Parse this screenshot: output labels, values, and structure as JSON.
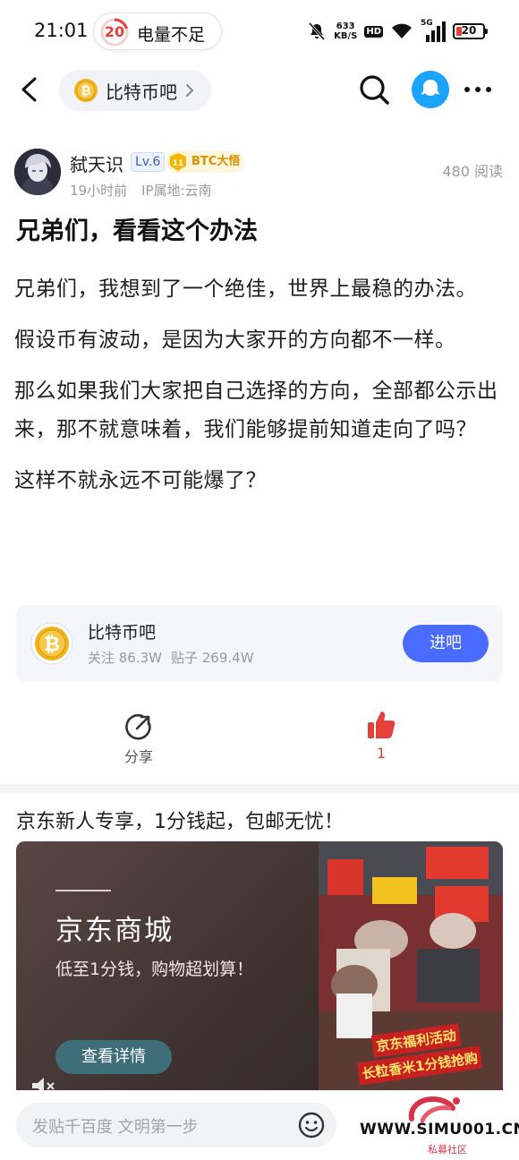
{
  "status_bar": {
    "time": "21:01",
    "battery_ring_value": "20",
    "battery_warning": "电量不足",
    "net_speed_value": "633",
    "net_speed_unit": "KB/S",
    "hd_label": "HD",
    "signal_label": "5G",
    "battery_level": "20",
    "battery_level_fraction": 0.2,
    "icons": [
      "mute-icon",
      "hd-icon",
      "wifi-icon",
      "signal-5g-icon",
      "battery-icon"
    ],
    "colors": {
      "battery_warning": "#e5413a"
    }
  },
  "nav": {
    "forum_name": "比特币吧",
    "icons": [
      "back-arrow-icon",
      "bitcoin-coin-icon",
      "chevron-right-icon",
      "search-icon",
      "assistant-icon",
      "more-icon"
    ]
  },
  "author": {
    "name": "弑天识",
    "level": "Lv.6",
    "title_badge_num": "11",
    "title_badge": "BTC大悟",
    "time_ago": "19小时前",
    "ip_location": "IP属地:云南",
    "read_count": "480 阅读"
  },
  "post": {
    "title": "兄弟们，看看这个办法",
    "paragraphs": [
      "兄弟们，我想到了一个绝佳，世界上最稳的办法。",
      "假设币有波动，是因为大家开的方向都不一样。",
      "那么如果我们大家把自己选择的方向，全部都公示出来，那不就意味着，我们能够提前知道走向了吗？",
      "这样不就永远不可能爆了？"
    ]
  },
  "forum_card": {
    "name": "比特币吧",
    "followers": "关注 86.3W",
    "posts": "贴子 269.4W",
    "enter_label": "进吧"
  },
  "actions": {
    "share_label": "分享",
    "like_count": "1",
    "colors": {
      "like": "#e5413a",
      "accent": "#4a6bff"
    }
  },
  "ad": {
    "headline": "京东新人专享，1分钱起，包邮无忧！",
    "brand": "京东商城",
    "slogan": "低至1分钱，购物超划算！",
    "cta": "查看详情",
    "promo_line1": "京东福利活动",
    "promo_line2": "长粒香米1分钱抢购"
  },
  "bottom": {
    "comment_placeholder": "发贴千百度 文明第一步",
    "watermark_site": "WWW.SIMU001.CN",
    "watermark_sub": "私募社区"
  }
}
